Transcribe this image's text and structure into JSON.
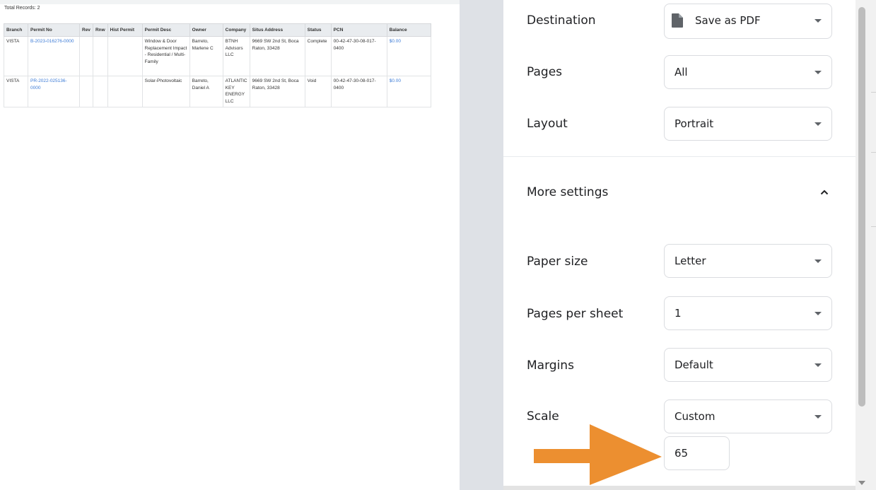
{
  "preview": {
    "total_records": "Total Records: 2",
    "columns": [
      "Branch",
      "Permit No",
      "Rev",
      "Rnw",
      "Hist Permit",
      "Permit Desc",
      "Owner",
      "Company",
      "Situs Address",
      "Status",
      "PCN",
      "Balance"
    ],
    "rows": [
      {
        "branch": "VISTA",
        "permit_no": "B-2023-016276-0000",
        "rev": "",
        "rnw": "",
        "hist_permit": "",
        "permit_desc": "Window & Door Replacement Impact - Residential / Multi-Family",
        "owner": "Barreto, Marlene C",
        "company": "BTNH Advisors LLC",
        "situs_address": "9669 SW 2nd St, Boca Raton, 33428",
        "status": "Complete",
        "pcn": "00-42-47-30-08-017-0400",
        "balance": "$0.00"
      },
      {
        "branch": "VISTA",
        "permit_no": "PR-2022-025136-0000",
        "rev": "",
        "rnw": "",
        "hist_permit": "",
        "permit_desc": "Solar-Photovoltaic",
        "owner": "Barreto, Daniel A",
        "company": "ATLANTIC KEY ENERGY LLC",
        "situs_address": "9669 SW 2nd St, Boca Raton, 33428",
        "status": "Void",
        "pcn": "00-42-47-30-08-017-0400",
        "balance": "$0.00"
      }
    ]
  },
  "settings": {
    "destination": {
      "label": "Destination",
      "value": "Save as PDF",
      "icon": "document-icon"
    },
    "pages": {
      "label": "Pages",
      "value": "All"
    },
    "layout": {
      "label": "Layout",
      "value": "Portrait"
    },
    "more_settings": {
      "label": "More settings",
      "icon": "chevron-up-icon"
    },
    "paper_size": {
      "label": "Paper size",
      "value": "Letter"
    },
    "pages_per_sheet": {
      "label": "Pages per sheet",
      "value": "1"
    },
    "margins": {
      "label": "Margins",
      "value": "Default"
    },
    "scale": {
      "label": "Scale",
      "value": "Custom",
      "custom_value": "65"
    }
  },
  "colors": {
    "accent_arrow": "#ec8f30",
    "link": "#3c7bd6",
    "border": "#dadce0"
  }
}
